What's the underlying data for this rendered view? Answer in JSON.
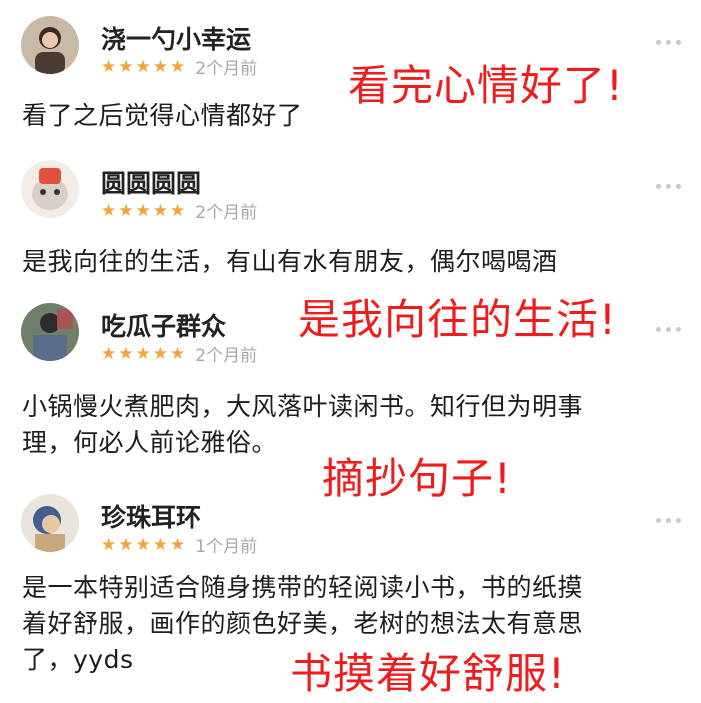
{
  "reviews": [
    {
      "username": "浇一勺小幸运",
      "stars": [
        "★",
        "★",
        "★",
        "★",
        "★"
      ],
      "time": "2个月前",
      "content": [
        "看了之后觉得心情都好了"
      ],
      "overlay": "看完心情好了!"
    },
    {
      "username": "圆圆圆圆",
      "stars": [
        "★",
        "★",
        "★",
        "★",
        "★"
      ],
      "time": "2个月前",
      "content": [
        "是我向往的生活，有山有水有朋友，偶尔喝喝酒"
      ],
      "overlay": "是我向往的生活!"
    },
    {
      "username": "吃瓜子群众",
      "stars": [
        "★",
        "★",
        "★",
        "★",
        "★"
      ],
      "time": "2个月前",
      "content": [
        "小锅慢火煮肥肉，大风落叶读闲书。知行但为明事",
        "理，何必人前论雅俗。"
      ],
      "overlay": "摘抄句子!"
    },
    {
      "username": "珍珠耳环",
      "stars": [
        "★",
        "★",
        "★",
        "★",
        "★"
      ],
      "time": "1个月前",
      "content": [
        "是一本特别适合随身携带的轻阅读小书，书的纸摸",
        "着好舒服，画作的颜色好美，老树的想法太有意思",
        "了，yyds"
      ],
      "overlay": "书摸着好舒服!"
    }
  ],
  "colors": {
    "star": "#f5a33b",
    "overlay": "#ee1c1c",
    "time": "#a8a8a8"
  },
  "icons": [
    "avatar",
    "star-icon",
    "more-icon"
  ]
}
